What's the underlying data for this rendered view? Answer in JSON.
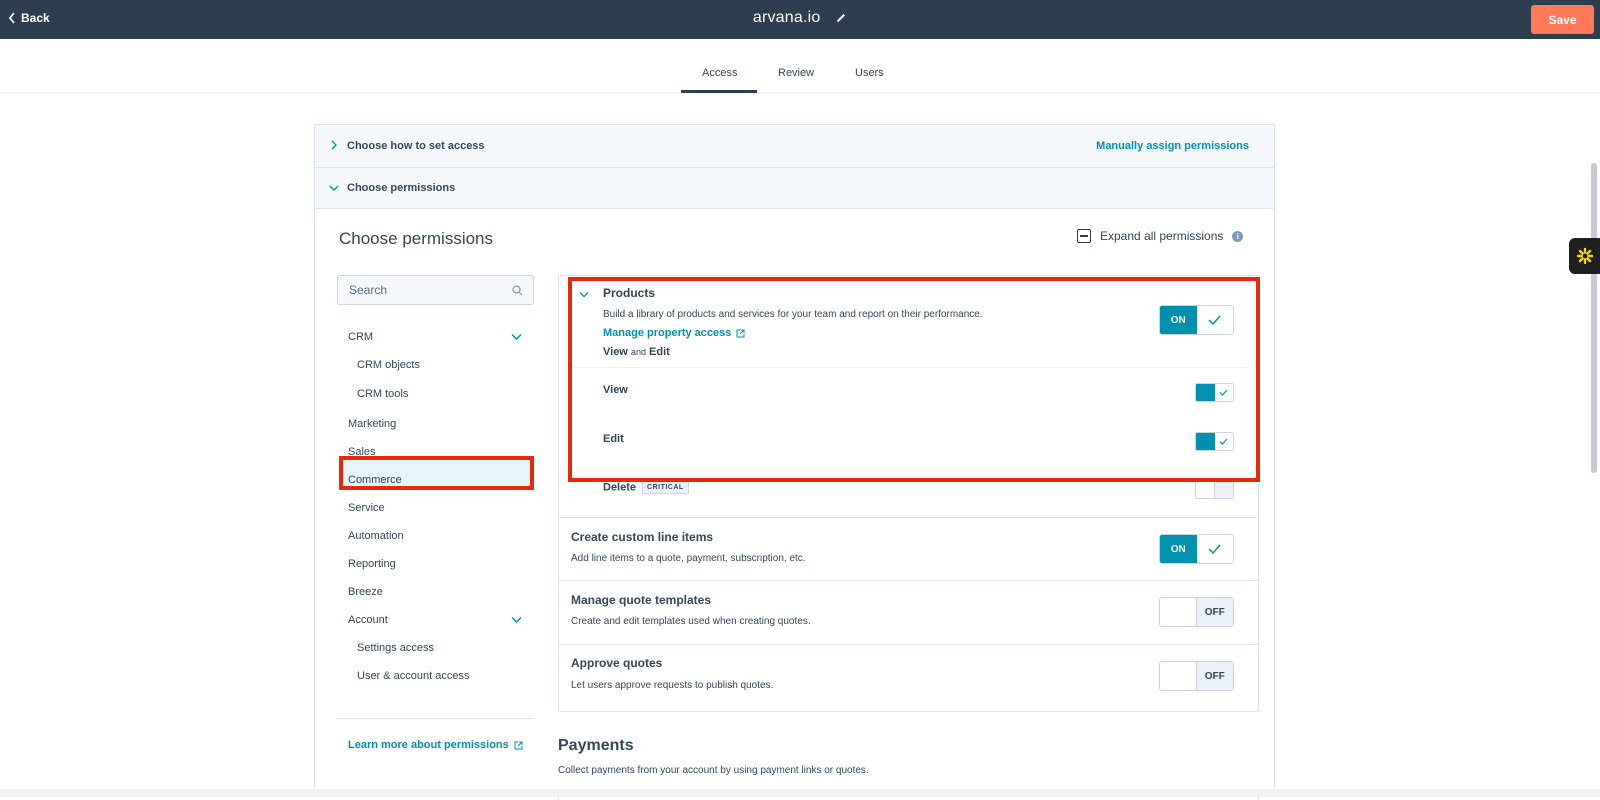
{
  "topbar": {
    "back_label": "Back",
    "title": "arvana.io",
    "save_label": "Save"
  },
  "tabs": [
    {
      "label": "Access",
      "active": true
    },
    {
      "label": "Review",
      "active": false
    },
    {
      "label": "Users",
      "active": false
    }
  ],
  "accordion": {
    "how_label": "Choose how to set access",
    "how_link": "Manually assign permissions",
    "perm_label": "Choose permissions"
  },
  "section": {
    "title": "Choose permissions",
    "expand_all": "Expand all permissions"
  },
  "search": {
    "placeholder": "Search"
  },
  "nav": {
    "crm": "CRM",
    "crm_objects": "CRM objects",
    "crm_tools": "CRM tools",
    "marketing": "Marketing",
    "sales": "Sales",
    "commerce": "Commerce",
    "service": "Service",
    "automation": "Automation",
    "reporting": "Reporting",
    "breeze": "Breeze",
    "account": "Account",
    "settings_access": "Settings access",
    "user_account_access": "User & account access",
    "learn_more": "Learn more about permissions"
  },
  "products": {
    "title": "Products",
    "desc": "Build a library of products and services for your team and report on their performance.",
    "manage_link": "Manage property access",
    "view_word": "View",
    "and_word": "and",
    "edit_word": "Edit",
    "toggle_label": "ON",
    "view_label": "View",
    "edit_label": "Edit",
    "delete_label": "Delete",
    "critical_badge": "CRITICAL"
  },
  "line_items": {
    "title": "Create custom line items",
    "desc": "Add line items to a quote, payment, subscription, etc.",
    "toggle_label": "ON"
  },
  "quote_templates": {
    "title": "Manage quote templates",
    "desc": "Create and edit templates used when creating quotes.",
    "toggle_label": "OFF"
  },
  "approve_quotes": {
    "title": "Approve quotes",
    "desc": "Let users approve requests to publish quotes.",
    "toggle_label": "OFF"
  },
  "payments": {
    "title": "Payments",
    "desc": "Collect payments from your account by using payment links or quotes."
  },
  "colors": {
    "topbar": "#2d3e50",
    "accent": "#0091ae",
    "save": "#ff7a59",
    "highlight": "#e8280d"
  }
}
